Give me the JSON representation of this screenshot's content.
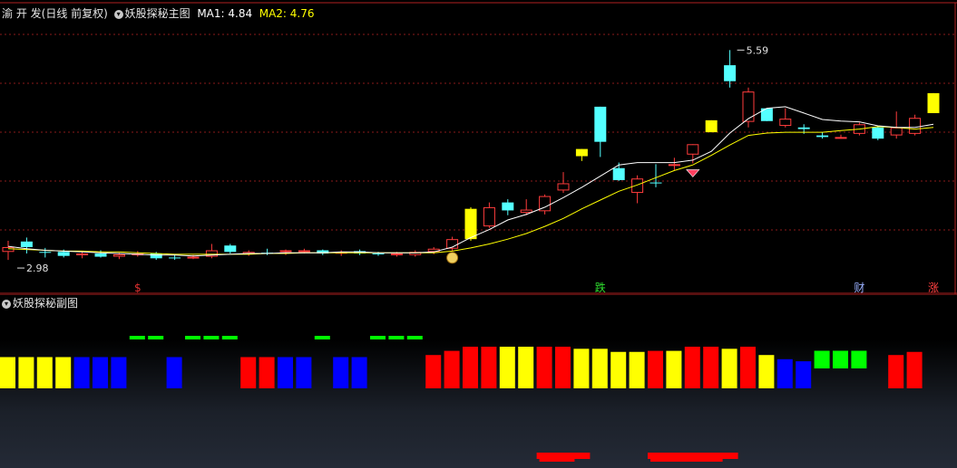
{
  "stock": {
    "name": "渝 开 发",
    "period": "(日线 前复权)"
  },
  "main_panel": {
    "indicator_name": "妖股探秘主图",
    "ma1_label": "MA1: 4.84",
    "ma2_label": "MA2: 4.76",
    "high_marker": "5.59",
    "low_marker": "2.98",
    "price_range": [
      2.7,
      5.9
    ],
    "candles": [
      {
        "o": 3.12,
        "h": 3.2,
        "l": 2.96,
        "c": 3.06,
        "k": "red"
      },
      {
        "o": 3.12,
        "h": 3.24,
        "l": 3.04,
        "c": 3.19,
        "k": "cyan"
      },
      {
        "o": 3.06,
        "h": 3.11,
        "l": 2.99,
        "c": 3.05,
        "k": "cyan"
      },
      {
        "o": 3.06,
        "h": 3.09,
        "l": 2.99,
        "c": 3.01,
        "k": "cyan"
      },
      {
        "o": 3.02,
        "h": 3.06,
        "l": 2.98,
        "c": 3.04,
        "k": "red"
      },
      {
        "o": 3.04,
        "h": 3.08,
        "l": 2.99,
        "c": 3.0,
        "k": "cyan"
      },
      {
        "o": 3.0,
        "h": 3.05,
        "l": 2.97,
        "c": 3.03,
        "k": "red"
      },
      {
        "o": 3.04,
        "h": 3.07,
        "l": 3.0,
        "c": 3.02,
        "k": "red"
      },
      {
        "o": 3.04,
        "h": 3.06,
        "l": 2.96,
        "c": 2.98,
        "k": "cyan"
      },
      {
        "o": 2.98,
        "h": 3.02,
        "l": 2.96,
        "c": 2.99,
        "k": "cyan"
      },
      {
        "o": 2.98,
        "h": 3.02,
        "l": 2.97,
        "c": 3.0,
        "k": "red"
      },
      {
        "o": 3.0,
        "h": 3.16,
        "l": 2.98,
        "c": 3.08,
        "k": "red"
      },
      {
        "o": 3.14,
        "h": 3.16,
        "l": 3.04,
        "c": 3.06,
        "k": "cyan"
      },
      {
        "o": 3.03,
        "h": 3.08,
        "l": 3.01,
        "c": 3.06,
        "k": "red"
      },
      {
        "o": 3.05,
        "h": 3.1,
        "l": 3.02,
        "c": 3.04,
        "k": "cyan"
      },
      {
        "o": 3.06,
        "h": 3.09,
        "l": 3.02,
        "c": 3.08,
        "k": "red"
      },
      {
        "o": 3.08,
        "h": 3.1,
        "l": 3.04,
        "c": 3.07,
        "k": "red"
      },
      {
        "o": 3.08,
        "h": 3.09,
        "l": 3.02,
        "c": 3.04,
        "k": "cyan"
      },
      {
        "o": 3.05,
        "h": 3.08,
        "l": 3.01,
        "c": 3.06,
        "k": "red"
      },
      {
        "o": 3.07,
        "h": 3.09,
        "l": 3.02,
        "c": 3.04,
        "k": "cyan"
      },
      {
        "o": 3.04,
        "h": 3.06,
        "l": 3.01,
        "c": 3.03,
        "k": "cyan"
      },
      {
        "o": 3.03,
        "h": 3.06,
        "l": 3.0,
        "c": 3.04,
        "k": "red"
      },
      {
        "o": 3.02,
        "h": 3.08,
        "l": 3.0,
        "c": 3.06,
        "k": "red"
      },
      {
        "o": 3.06,
        "h": 3.12,
        "l": 3.03,
        "c": 3.1,
        "k": "red"
      },
      {
        "o": 3.1,
        "h": 3.25,
        "l": 3.07,
        "c": 3.22,
        "k": "red"
      },
      {
        "o": 3.22,
        "h": 3.62,
        "l": 3.2,
        "c": 3.6,
        "k": "yellow"
      },
      {
        "o": 3.38,
        "h": 3.68,
        "l": 3.36,
        "c": 3.62,
        "k": "red"
      },
      {
        "o": 3.58,
        "h": 3.72,
        "l": 3.52,
        "c": 3.68,
        "k": "cyan"
      },
      {
        "o": 3.55,
        "h": 3.72,
        "l": 3.52,
        "c": 3.59,
        "k": "red"
      },
      {
        "o": 3.57,
        "h": 3.78,
        "l": 3.53,
        "c": 3.76,
        "k": "red"
      },
      {
        "o": 3.83,
        "h": 4.06,
        "l": 3.8,
        "c": 3.92,
        "k": "red"
      },
      {
        "o": 4.26,
        "h": 4.35,
        "l": 4.2,
        "c": 4.35,
        "k": "yellow"
      },
      {
        "o": 4.88,
        "h": 4.88,
        "l": 4.25,
        "c": 4.44,
        "k": "cyan"
      },
      {
        "o": 4.11,
        "h": 4.18,
        "l": 3.95,
        "c": 3.96,
        "k": "cyan"
      },
      {
        "o": 3.98,
        "h": 4.02,
        "l": 3.67,
        "c": 3.8,
        "k": "red"
      },
      {
        "o": 3.93,
        "h": 4.16,
        "l": 3.87,
        "c": 3.92,
        "k": "cyan"
      },
      {
        "o": 4.16,
        "h": 4.24,
        "l": 4.08,
        "c": 4.16,
        "k": "red"
      },
      {
        "o": 4.28,
        "h": 4.41,
        "l": 4.17,
        "c": 4.41,
        "k": "red"
      },
      {
        "o": 4.71,
        "h": 4.71,
        "l": 4.56,
        "c": 4.56,
        "k": "yellow"
      },
      {
        "o": 5.4,
        "h": 5.59,
        "l": 5.12,
        "c": 5.2,
        "k": "cyan"
      },
      {
        "o": 4.69,
        "h": 5.12,
        "l": 4.62,
        "c": 5.07,
        "k": "red"
      },
      {
        "o": 4.86,
        "h": 4.86,
        "l": 4.7,
        "c": 4.7,
        "k": "cyan"
      },
      {
        "o": 4.73,
        "h": 4.86,
        "l": 4.62,
        "c": 4.64,
        "k": "red"
      },
      {
        "o": 4.62,
        "h": 4.66,
        "l": 4.54,
        "c": 4.6,
        "k": "cyan"
      },
      {
        "o": 4.5,
        "h": 4.56,
        "l": 4.48,
        "c": 4.52,
        "k": "cyan"
      },
      {
        "o": 4.5,
        "h": 4.53,
        "l": 4.48,
        "c": 4.5,
        "k": "red"
      },
      {
        "o": 4.54,
        "h": 4.68,
        "l": 4.52,
        "c": 4.66,
        "k": "red"
      },
      {
        "o": 4.62,
        "h": 4.64,
        "l": 4.46,
        "c": 4.48,
        "k": "cyan"
      },
      {
        "o": 4.52,
        "h": 4.82,
        "l": 4.48,
        "c": 4.62,
        "k": "red"
      },
      {
        "o": 4.54,
        "h": 4.78,
        "l": 4.52,
        "c": 4.74,
        "k": "red"
      },
      {
        "o": 4.8,
        "h": 5.05,
        "l": 4.8,
        "c": 5.05,
        "k": "yellow"
      }
    ],
    "ma1": [
      3.13,
      3.1,
      3.08,
      3.07,
      3.06,
      3.05,
      3.04,
      3.03,
      3.02,
      3.02,
      3.01,
      3.02,
      3.03,
      3.04,
      3.04,
      3.05,
      3.05,
      3.05,
      3.06,
      3.06,
      3.05,
      3.05,
      3.05,
      3.06,
      3.12,
      3.24,
      3.34,
      3.46,
      3.53,
      3.62,
      3.74,
      3.87,
      4.01,
      4.15,
      4.18,
      4.18,
      4.18,
      4.21,
      4.32,
      4.55,
      4.73,
      4.86,
      4.88,
      4.8,
      4.72,
      4.7,
      4.69,
      4.64,
      4.62,
      4.62,
      4.66
    ],
    "ma2": [
      3.1,
      3.09,
      3.08,
      3.07,
      3.07,
      3.06,
      3.06,
      3.05,
      3.04,
      3.03,
      3.03,
      3.03,
      3.03,
      3.03,
      3.04,
      3.04,
      3.05,
      3.05,
      3.05,
      3.05,
      3.05,
      3.05,
      3.05,
      3.05,
      3.07,
      3.11,
      3.16,
      3.22,
      3.29,
      3.38,
      3.48,
      3.6,
      3.71,
      3.82,
      3.9,
      3.99,
      4.08,
      4.15,
      4.27,
      4.4,
      4.52,
      4.55,
      4.56,
      4.56,
      4.56,
      4.58,
      4.6,
      4.63,
      4.62,
      4.6,
      4.62
    ],
    "events": [
      {
        "index": 7,
        "label": "$",
        "color": "#e03030"
      },
      {
        "index": 32,
        "label": "跌",
        "color": "#30e030"
      },
      {
        "index": 46,
        "label": "财",
        "color": "#9ab0ff"
      },
      {
        "index": 50,
        "label": "涨",
        "color": "#ff4040"
      }
    ],
    "money_icon_index": 24,
    "diamond_icon_index": 37
  },
  "sub_panel": {
    "indicator_name": "妖股探秘副图",
    "bars": [
      {
        "c": "yellow",
        "v": 3
      },
      {
        "c": "yellow",
        "v": 3
      },
      {
        "c": "yellow",
        "v": 3
      },
      {
        "c": "yellow",
        "v": 3
      },
      {
        "c": "blue",
        "v": 3
      },
      {
        "c": "blue",
        "v": 3
      },
      {
        "c": "blue",
        "v": 3
      },
      {
        "c": "greenline",
        "v": 6
      },
      {
        "c": "greenline",
        "v": 6
      },
      {
        "c": "blue",
        "v": 3
      },
      {
        "c": "greenline",
        "v": 6
      },
      {
        "c": "greenline",
        "v": 6
      },
      {
        "c": "greenline",
        "v": 6
      },
      {
        "c": "red",
        "v": 3
      },
      {
        "c": "red",
        "v": 3
      },
      {
        "c": "blue",
        "v": 3
      },
      {
        "c": "blue",
        "v": 3
      },
      {
        "c": "greenline",
        "v": 6
      },
      {
        "c": "blue",
        "v": 3
      },
      {
        "c": "blue",
        "v": 3
      },
      {
        "c": "greenline",
        "v": 6
      },
      {
        "c": "greenline",
        "v": 6
      },
      {
        "c": "greenline",
        "v": 6
      },
      {
        "c": "red",
        "v": 3.2
      },
      {
        "c": "red",
        "v": 3.6
      },
      {
        "c": "red",
        "v": 4
      },
      {
        "c": "red",
        "v": 4
      },
      {
        "c": "yellow",
        "v": 4
      },
      {
        "c": "yellow",
        "v": 4
      },
      {
        "c": "red",
        "v": 4
      },
      {
        "c": "red",
        "v": 4
      },
      {
        "c": "yellow",
        "v": 3.8
      },
      {
        "c": "yellow",
        "v": 3.8
      },
      {
        "c": "yellow",
        "v": 3.5
      },
      {
        "c": "yellow",
        "v": 3.5
      },
      {
        "c": "red",
        "v": 3.6
      },
      {
        "c": "yellow",
        "v": 3.6
      },
      {
        "c": "red",
        "v": 4
      },
      {
        "c": "red",
        "v": 4
      },
      {
        "c": "yellow",
        "v": 3.8
      },
      {
        "c": "red",
        "v": 4
      },
      {
        "c": "yellow",
        "v": 3.2
      },
      {
        "c": "blue",
        "v": 2.8
      },
      {
        "c": "blue",
        "v": 2.6
      },
      {
        "c": "greenbox",
        "v": 5
      },
      {
        "c": "greenbox",
        "v": 5
      },
      {
        "c": "greenbox",
        "v": 5
      },
      {
        "c": "empty",
        "v": 0
      },
      {
        "c": "red",
        "v": 3.2
      },
      {
        "c": "red",
        "v": 3.5
      }
    ],
    "bottom_bars": [
      {
        "from": 29,
        "to": 31,
        "segment_count": 3
      },
      {
        "from": 35,
        "to": 39,
        "segment_count": 5
      }
    ]
  },
  "colors": {
    "up": "#ff3c3c",
    "down": "#54ffff",
    "limit": "#ffff00",
    "ma1": "#ffffff",
    "ma2": "#ffff00",
    "bar_red": "#ff0000",
    "bar_yellow": "#ffff00",
    "bar_blue": "#0000ff",
    "bar_green": "#00ff00",
    "grid": "#8a1a1a"
  }
}
